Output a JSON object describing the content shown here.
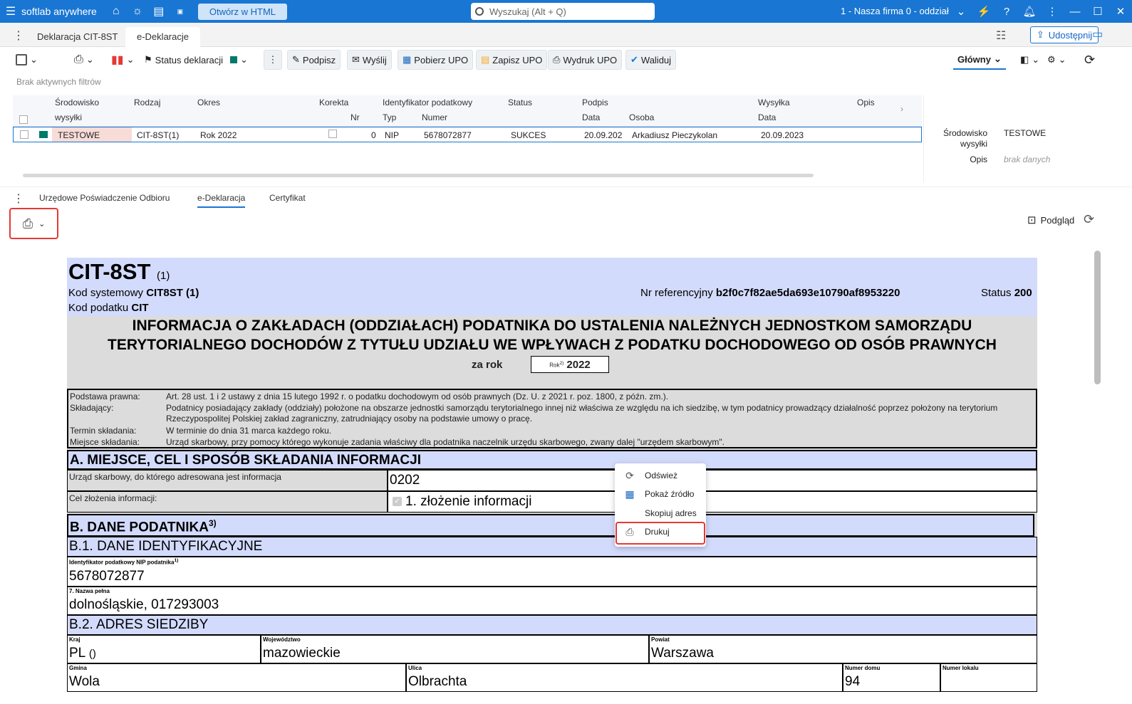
{
  "titlebar": {
    "app_name": "softlab anywhere",
    "html_button": "Otwórz w HTML",
    "search_placeholder": "Wyszukaj (Alt + Q)",
    "company": "1 - Nasza firma 0 - oddział",
    "brand_color": "#1976d2"
  },
  "tabs_top": [
    "Deklaracja CIT-8ST",
    "e-Deklaracje"
  ],
  "share_label": "Udostępnij",
  "toolbar": {
    "status": "Status deklaracji",
    "podpisz": "Podpisz",
    "wyslij": "Wyślij",
    "pobierz_upo": "Pobierz UPO",
    "zapisz_upo": "Zapisz UPO",
    "wydruk_upo": "Wydruk UPO",
    "waliduj": "Waliduj",
    "view": "Główny"
  },
  "filters": "Brak aktywnych filtrów",
  "grid": {
    "headers": {
      "srodowisko": "Środowisko",
      "wysylki": "wysyłki",
      "rodzaj": "Rodzaj",
      "okres": "Okres",
      "korekta": "Korekta",
      "nr": "Nr",
      "identyfikator": "Identyfikator podatkowy",
      "typ": "Typ",
      "numer": "Numer",
      "status": "Status",
      "podpis": "Podpis",
      "data": "Data",
      "osoba": "Osoba",
      "wysylka": "Wysyłka",
      "data2": "Data",
      "opis": "Opis"
    },
    "row": {
      "srodowisko": "TESTOWE",
      "rodzaj": "CIT-8ST(1)",
      "okres": "Rok 2022",
      "nr": "0",
      "typ": "NIP",
      "numer": "5678072877",
      "status": "SUKCES",
      "podpis_data": "20.09.202",
      "osoba": "Arkadiusz Pieczykolan",
      "wysylka_data": "20.09.2023"
    }
  },
  "side": {
    "srodowisko_label": "Środowisko",
    "wysylki_label": "wysyłki",
    "srodowisko_value": "TESTOWE",
    "opis_label": "Opis",
    "opis_value": "brak danych"
  },
  "tabs_bottom": [
    "Urzędowe Poświadczenie Odbioru",
    "e-Deklaracja",
    "Certyfikat"
  ],
  "podglad": "Podgląd",
  "doc": {
    "form": "CIT-8ST",
    "form_variant": "(1)",
    "kod_sys_label": "Kod systemowy",
    "kod_sys": "CIT8ST (1)",
    "kod_pod_label": "Kod podatku",
    "kod_pod": "CIT",
    "nr_ref_label": "Nr referencyjny",
    "nr_ref": "b2f0c7f82ae5da693e10790af8953220",
    "status_label": "Status",
    "status": "200",
    "title1": "INFORMACJA O ZAKŁADACH (ODDZIAŁACH) PODATNIKA DO USTALENIA NALEŻNYCH JEDNOSTKOM SAMORZĄDU",
    "title2": "TERYTORIALNEGO DOCHODÓW Z TYTUŁU UDZIAŁU WE WPŁYWACH Z PODATKU DOCHODOWEGO OD OSÓB PRAWNYCH",
    "za_rok": "za rok",
    "rok_label": "Rok",
    "rok_sup": "2)",
    "rok": "2022",
    "legal": {
      "l1": "Podstawa prawna:",
      "t1": "Art. 28 ust. 1 i 2 ustawy z dnia 15 lutego 1992 r. o podatku dochodowym od osób prawnych (Dz. U. z 2021 r. poz. 1800, z późn. zm.).",
      "l2": "Składający:",
      "t2": "Podatnicy posiadający zakłady (oddziały) położone na obszarze jednostki samorządu terytorialnego innej niż właściwa ze względu na ich siedzibę, w tym podatnicy prowadzący działalność poprzez położony na terytorium Rzeczypospolitej Polskiej zakład zagraniczny, zatrudniający osoby na podstawie umowy o pracę.",
      "l3": "Termin składania:",
      "t3": "W terminie do dnia 31 marca każdego roku.",
      "l4": "Miejsce składania:",
      "t4": "Urząd skarbowy, przy pomocy którego wykonuje zadania właściwy dla podatnika naczelnik urzędu skarbowego, zwany dalej \"urzędem skarbowym\"."
    },
    "secA": "A. MIEJSCE, CEL I SPOSÓB SKŁADANIA INFORMACJI",
    "urzad_label": "Urząd skarbowy, do którego adresowana jest informacja",
    "urzad_value": "0202",
    "cel_label": "Cel złożenia informacji:",
    "cel_value": "1. złożenie informacji",
    "secB": "B. DANE PODATNIKA",
    "secB_sup": "3)",
    "secB1": "B.1. DANE IDENTYFIKACYJNE",
    "nip_label": "Identyfikator podatkowy NIP podatnika",
    "nip_sup": "1)",
    "nip": "5678072877",
    "nazwa_label": "7. Nazwa pełna",
    "nazwa": "dolnośląskie, 017293003",
    "secB2": "B.2. ADRES SIEDZIBY",
    "kraj_label": "Kraj",
    "kraj": "PL ",
    "kraj_paren": "()",
    "woj_label": "Województwo",
    "woj": "mazowieckie",
    "powiat_label": "Powiat",
    "powiat": "Warszawa",
    "gmina_label": "Gmina",
    "gmina": "Wola",
    "ulica_label": "Ulica",
    "ulica": "Olbrachta",
    "nr_domu_label": "Numer domu",
    "nr_domu": "94",
    "nr_lokalu_label": "Numer lokalu"
  },
  "context_menu": {
    "items": [
      "Odśwież",
      "Pokaż źródło",
      "Skopiuj adres",
      "Drukuj"
    ]
  }
}
